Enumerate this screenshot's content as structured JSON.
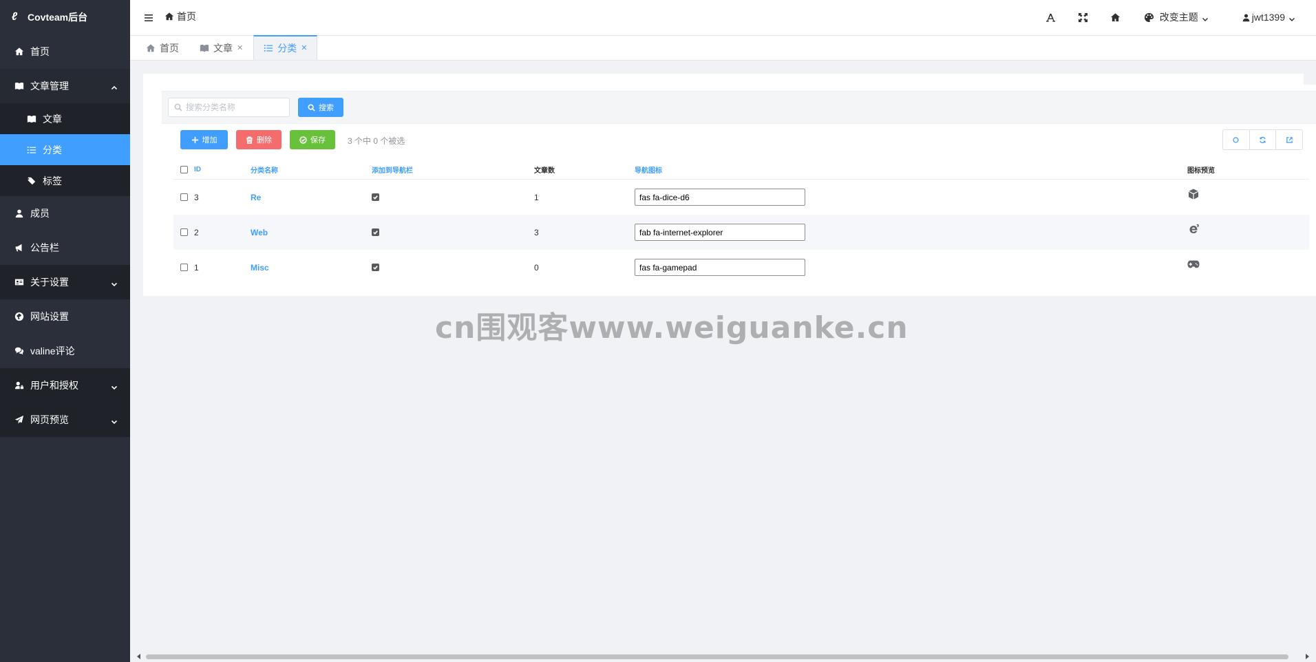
{
  "app": {
    "title": "Covteam后台"
  },
  "sidebar": {
    "items": [
      {
        "label": "首页",
        "icon": "home-icon"
      },
      {
        "label": "文章管理",
        "icon": "book-icon",
        "expanded": true,
        "children": [
          {
            "label": "文章",
            "icon": "book-icon"
          },
          {
            "label": "分类",
            "icon": "list-icon",
            "active": true
          },
          {
            "label": "标签",
            "icon": "tags-icon"
          }
        ]
      },
      {
        "label": "成员",
        "icon": "user-icon"
      },
      {
        "label": "公告栏",
        "icon": "bullhorn-icon"
      },
      {
        "label": "关于设置",
        "icon": "id-card-icon",
        "expanded": false
      },
      {
        "label": "网站设置",
        "icon": "globe-icon"
      },
      {
        "label": "valine评论",
        "icon": "comments-icon"
      },
      {
        "label": "用户和授权",
        "icon": "user-lock-icon",
        "expanded": false
      },
      {
        "label": "网页预览",
        "icon": "paper-plane-icon",
        "expanded": false
      }
    ]
  },
  "header": {
    "breadcrumb": "首页",
    "theme_label": "改变主题",
    "username": "jwt1399"
  },
  "tabs": [
    {
      "label": "首页",
      "closable": false,
      "active": false
    },
    {
      "label": "文章",
      "closable": true,
      "active": false
    },
    {
      "label": "分类",
      "closable": true,
      "active": true
    }
  ],
  "search": {
    "placeholder": "搜索分类名称",
    "button_label": "搜索"
  },
  "actions": {
    "add_label": "增加",
    "delete_label": "删除",
    "save_label": "保存",
    "selection_text": "3 个中 0 个被选"
  },
  "table": {
    "columns": {
      "id": "ID",
      "name": "分类名称",
      "add_to_nav": "添加到导航栏",
      "article_count": "文章数",
      "nav_icon": "导航图标",
      "icon_preview": "图标预览"
    },
    "rows": [
      {
        "id": "3",
        "name": "Re",
        "add_to_nav": true,
        "article_count": "1",
        "nav_icon": "fas fa-dice-d6",
        "preview": "dice-icon"
      },
      {
        "id": "2",
        "name": "Web",
        "add_to_nav": true,
        "article_count": "3",
        "nav_icon": "fab fa-internet-explorer",
        "preview": "internet-explorer-icon"
      },
      {
        "id": "1",
        "name": "Misc",
        "add_to_nav": true,
        "article_count": "0",
        "nav_icon": "fas fa-gamepad",
        "preview": "gamepad-icon"
      }
    ]
  },
  "watermark": "cn围观客www.weiguanke.cn",
  "colors": {
    "sidebar_bg": "#2b2f3a",
    "primary": "#409eff",
    "danger": "#f56c6c",
    "success": "#67c23a"
  }
}
